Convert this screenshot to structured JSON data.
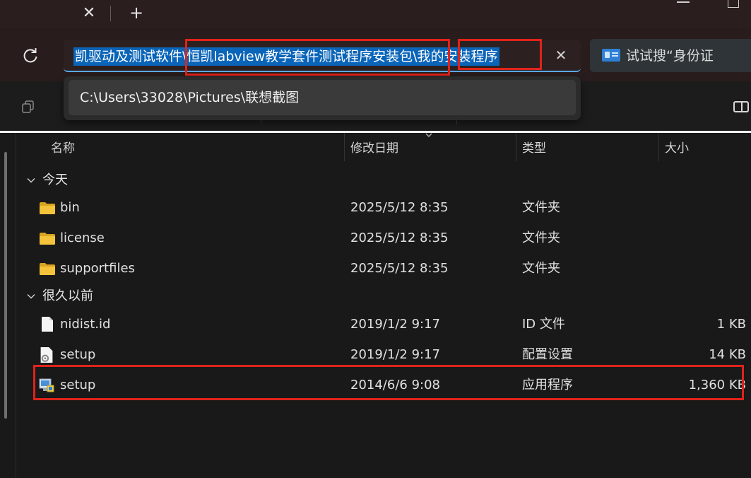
{
  "browser": {
    "tab_close_symbol": "✕",
    "tab_new_symbol": "+"
  },
  "address_bar": {
    "path_text": "凯驱动及测试软件\\恒凯labview教学套件测试程序安装包\\我的安装程序",
    "clear_symbol": "✕",
    "suggestion": "C:\\Users\\33028\\Pictures\\联想截图"
  },
  "search": {
    "text": "试试搜“身份证"
  },
  "columns": {
    "name": "名称",
    "date": "修改日期",
    "type": "类型",
    "size": "大小"
  },
  "groups": [
    {
      "label": "今天",
      "files": [
        {
          "name": "bin",
          "date": "2025/5/12 8:35",
          "type": "文件夹",
          "size": "",
          "icon": "folder-icon"
        },
        {
          "name": "license",
          "date": "2025/5/12 8:35",
          "type": "文件夹",
          "size": "",
          "icon": "folder-icon"
        },
        {
          "name": "supportfiles",
          "date": "2025/5/12 8:35",
          "type": "文件夹",
          "size": "",
          "icon": "folder-icon"
        }
      ]
    },
    {
      "label": "很久以前",
      "files": [
        {
          "name": "nidist.id",
          "date": "2019/1/2 9:17",
          "type": "ID 文件",
          "size": "1 KB",
          "icon": "file-icon"
        },
        {
          "name": "setup",
          "date": "2019/1/2 9:17",
          "type": "配置设置",
          "size": "14 KB",
          "icon": "config-file-icon"
        },
        {
          "name": "setup",
          "date": "2014/6/6 9:08",
          "type": "应用程序",
          "size": "1,360 KB",
          "icon": "installer-icon"
        }
      ]
    }
  ],
  "colors": {
    "highlight_blue": "#0a64b8",
    "annotation_red": "#e0231a",
    "folder_yellow": "#f3c33b"
  }
}
